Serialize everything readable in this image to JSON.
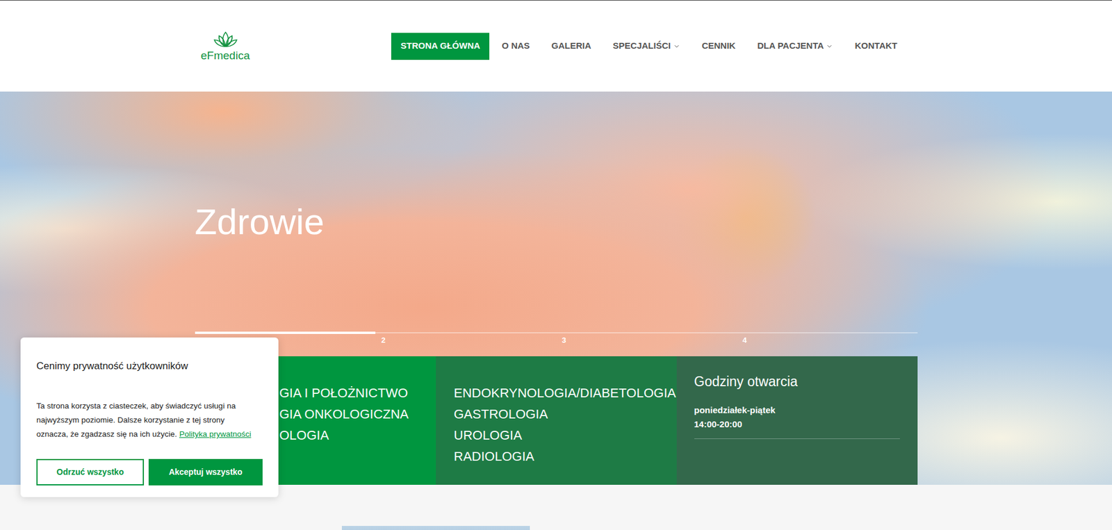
{
  "logo": {
    "text": "eFmedica"
  },
  "nav": [
    {
      "label": "STRONA GŁÓWNA",
      "selected": true,
      "dropdown": false
    },
    {
      "label": "O NAS",
      "selected": false,
      "dropdown": false
    },
    {
      "label": "GALERIA",
      "selected": false,
      "dropdown": false
    },
    {
      "label": "SPECJALIŚCI",
      "selected": false,
      "dropdown": true
    },
    {
      "label": "CENNIK",
      "selected": false,
      "dropdown": false
    },
    {
      "label": "DLA PACJENTA",
      "selected": false,
      "dropdown": true
    },
    {
      "label": "KONTAKT",
      "selected": false,
      "dropdown": false
    }
  ],
  "hero": {
    "title": "Zdrowie"
  },
  "slider": {
    "current_level": 1,
    "labels": [
      "2",
      "3",
      "4"
    ]
  },
  "specialties": [
    {
      "items": [
        "GIA I POŁOŻNICTWO",
        "GIA ONKOLOGICZNA",
        "OLOGIA"
      ]
    },
    {
      "items": [
        "ENDOKRYNOLOGIA/DIABETOLOGIA",
        "GASTROLOGIA",
        "UROLOGIA",
        "RADIOLOGIA"
      ]
    }
  ],
  "hours": {
    "title": "Godziny otwarcia",
    "days": "poniedziałek-piątek",
    "time": "14:00-20:00"
  },
  "cookie": {
    "title": "Cenimy prywatność użytkowników",
    "body": "Ta strona korzysta z ciasteczek, aby świadczyć usługi na najwyższym poziomie. Dalsze korzystanie z tej strony oznacza, że zgadzasz się na ich użycie.",
    "link": "Polityka prywatności",
    "buttons": [
      {
        "label": "Odrzuć wszystko",
        "kind": "outline"
      },
      {
        "label": "Akceptuj wszystko",
        "kind": "filled"
      }
    ]
  }
}
